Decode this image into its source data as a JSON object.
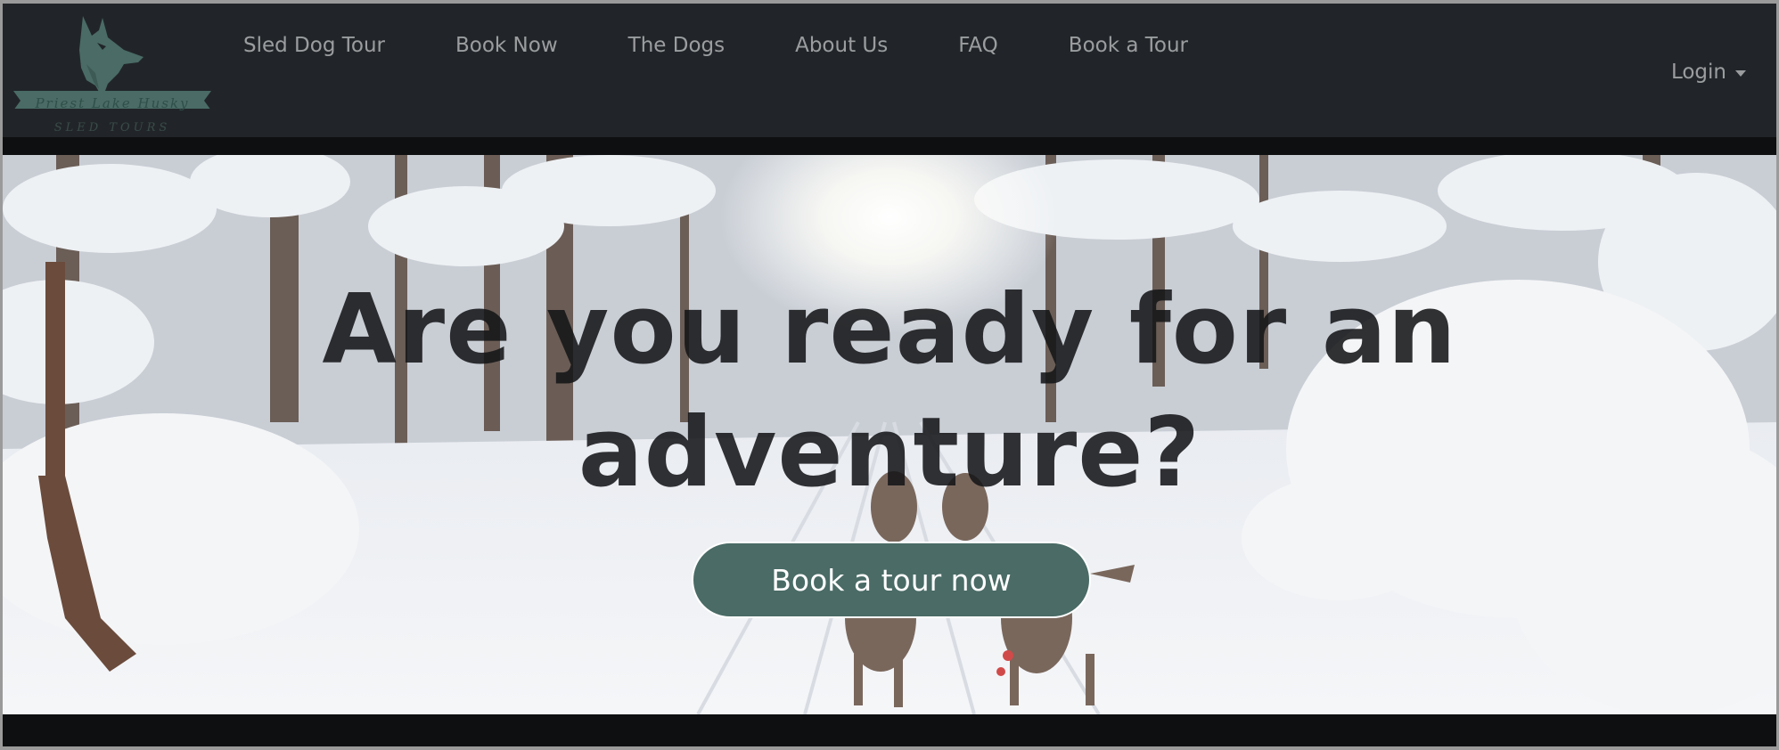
{
  "brand": {
    "name": "Priest Lake Husky",
    "tagline": "SLED TOURS",
    "logo_icon": "husky-head-icon",
    "accent": "#4a6b66"
  },
  "nav": {
    "links": [
      {
        "label": "Sled Dog Tour"
      },
      {
        "label": "Book Now"
      },
      {
        "label": "The Dogs"
      },
      {
        "label": "About Us"
      },
      {
        "label": "FAQ"
      },
      {
        "label": "Book a Tour"
      }
    ],
    "login_label": "Login",
    "login_icon": "caret-down-icon"
  },
  "hero": {
    "title_line1": "Are you ready for an",
    "title_line2": "adventure?",
    "cta_label": "Book a tour now",
    "background": "snowy forest trail with sled dogs"
  },
  "colors": {
    "navbar": "#212529",
    "nav_text": "#9a9c9e",
    "cta_bg": "#4a6b66",
    "title_text": "#151719"
  }
}
